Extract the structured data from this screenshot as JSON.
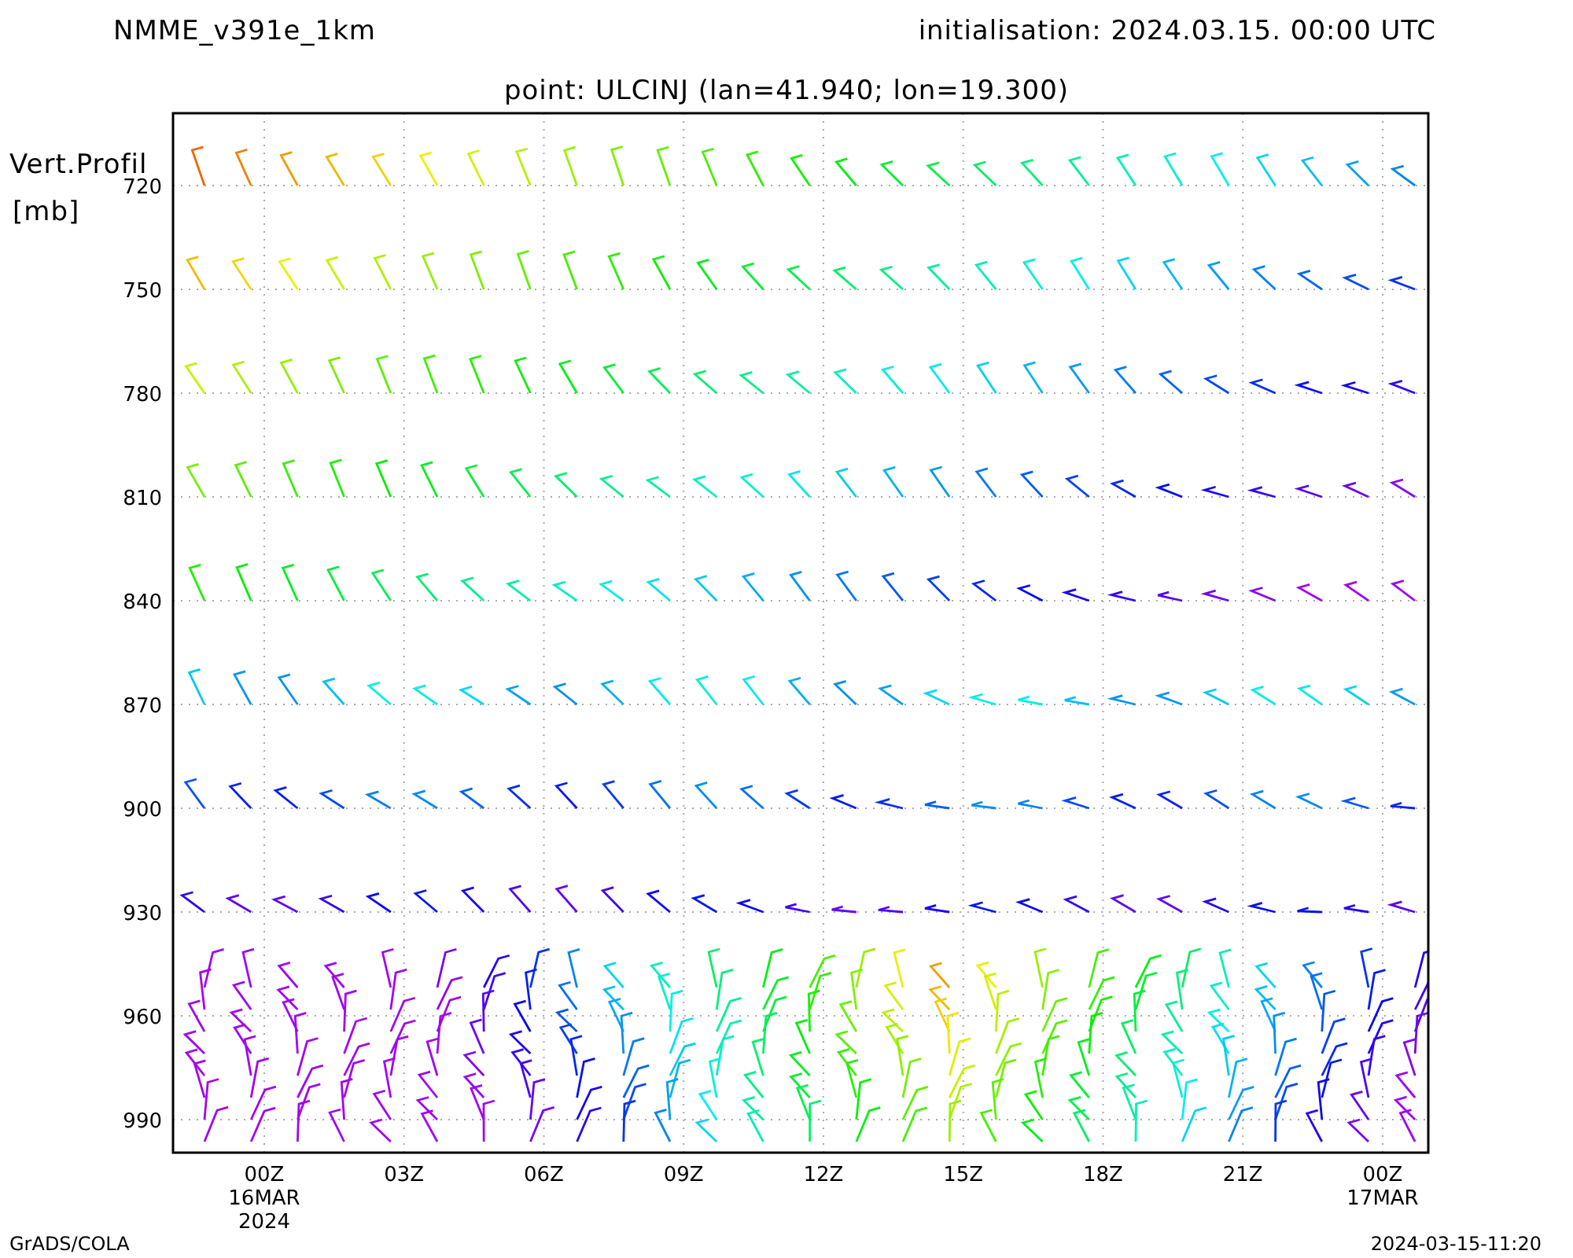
{
  "header": {
    "model": "NMME_v391e_1km",
    "initialisation": "initialisation: 2024.03.15. 00:00 UTC",
    "point": "point: ULCINJ (lan=41.940; lon=19.300)"
  },
  "chart": {
    "ylabel_lines": [
      "Vert.Profil",
      "[mb]"
    ],
    "yticks": [
      "720",
      "750",
      "780",
      "810",
      "840",
      "870",
      "900",
      "930",
      "960",
      "990"
    ],
    "xticks": [
      {
        "label": "00Z",
        "sub": [
          "16MAR",
          "2024"
        ]
      },
      {
        "label": "03Z"
      },
      {
        "label": "06Z"
      },
      {
        "label": "09Z"
      },
      {
        "label": "12Z"
      },
      {
        "label": "15Z"
      },
      {
        "label": "18Z"
      },
      {
        "label": "21Z"
      },
      {
        "label": "00Z",
        "sub": [
          "17MAR"
        ]
      }
    ]
  },
  "footer": {
    "left": "GrADS/COLA",
    "right": "2024-03-15-11:20"
  }
}
